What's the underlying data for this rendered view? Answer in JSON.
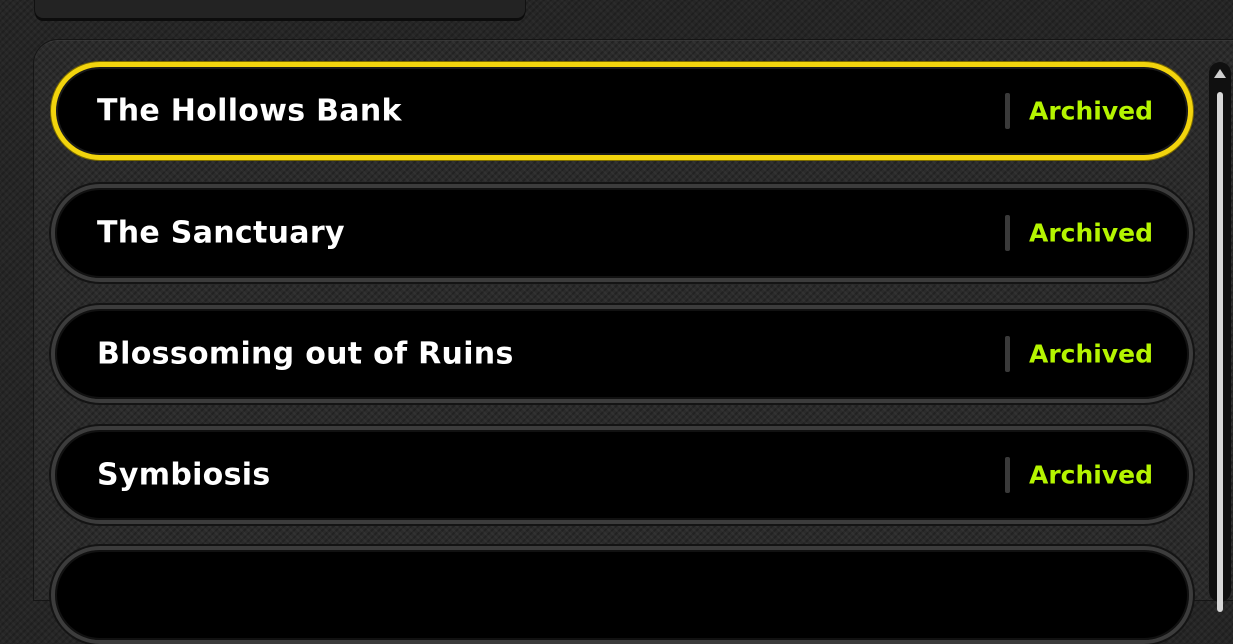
{
  "entries": [
    {
      "title": "The Hollows Bank",
      "status": "Archived",
      "selected": true
    },
    {
      "title": "The Sanctuary",
      "status": "Archived",
      "selected": false
    },
    {
      "title": "Blossoming out of Ruins",
      "status": "Archived",
      "selected": false
    },
    {
      "title": "Symbiosis",
      "status": "Archived",
      "selected": false
    },
    {
      "title": "",
      "status": "",
      "selected": false
    }
  ],
  "colors": {
    "selected_border": "#f2d40d",
    "status_text": "#b5f500",
    "title_text": "#ffffff",
    "row_background": "#000000"
  },
  "icons": {
    "scroll_up": "triangle-up-icon"
  }
}
